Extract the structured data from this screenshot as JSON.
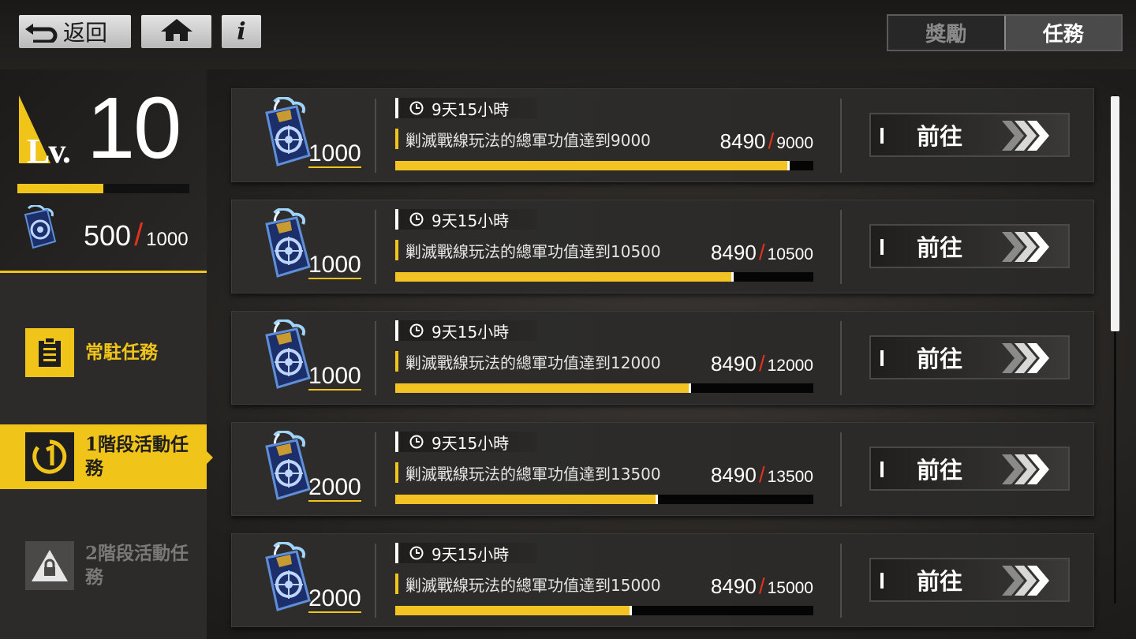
{
  "header": {
    "back_label": "返回",
    "info_label": "i",
    "tabs": [
      {
        "label": "獎勵",
        "active": false
      },
      {
        "label": "任務",
        "active": true
      }
    ]
  },
  "player": {
    "level_prefix": "Lv.",
    "level": "10",
    "xp_fraction": 0.5,
    "points_current": "500",
    "points_max": "1000"
  },
  "categories": [
    {
      "label": "常駐任務",
      "state": "normal",
      "icon": "clipboard-icon"
    },
    {
      "label": "1階段活動任務",
      "state": "selected",
      "icon": "stage-one-icon"
    },
    {
      "label": "2階段活動任務",
      "state": "locked",
      "icon": "lock-icon"
    }
  ],
  "tasks": [
    {
      "reward": "1000",
      "time_left": "9天15小時",
      "description": "剿滅戰線玩法的總軍功值達到9000",
      "current": "8490",
      "goal": "9000",
      "progress": 0.943,
      "go_label": "前往"
    },
    {
      "reward": "1000",
      "time_left": "9天15小時",
      "description": "剿滅戰線玩法的總軍功值達到10500",
      "current": "8490",
      "goal": "10500",
      "progress": 0.809,
      "go_label": "前往"
    },
    {
      "reward": "1000",
      "time_left": "9天15小時",
      "description": "剿滅戰線玩法的總軍功值達到12000",
      "current": "8490",
      "goal": "12000",
      "progress": 0.708,
      "go_label": "前往"
    },
    {
      "reward": "2000",
      "time_left": "9天15小時",
      "description": "剿滅戰線玩法的總軍功值達到13500",
      "current": "8490",
      "goal": "13500",
      "progress": 0.629,
      "go_label": "前往"
    },
    {
      "reward": "2000",
      "time_left": "9天15小時",
      "description": "剿滅戰線玩法的總軍功值達到15000",
      "current": "8490",
      "goal": "15000",
      "progress": 0.566,
      "go_label": "前往"
    }
  ],
  "colors": {
    "accent": "#f0c419",
    "slash": "#e0331c",
    "panel": "#2c2b29"
  },
  "scroll_fraction": 0.46
}
